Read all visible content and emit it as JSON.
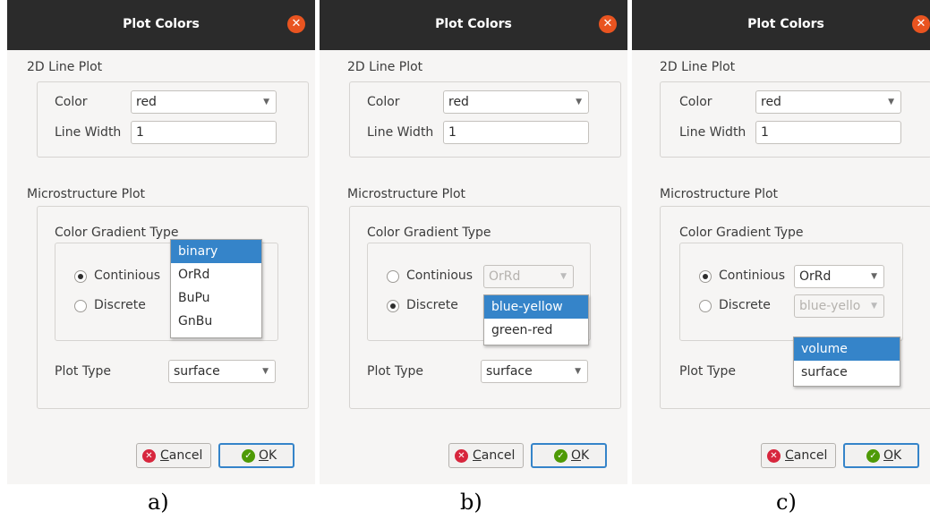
{
  "dialog_title": "Plot Colors",
  "close_glyph": "✕",
  "sections": {
    "line_plot": "2D Line Plot",
    "color_label": "Color",
    "color_value": "red",
    "line_width_label": "Line Width",
    "line_width_value": "1",
    "micro_plot": "Microstructure Plot",
    "gradient_type": "Color Gradient Type",
    "continuous": "Continious",
    "discrete": "Discrete",
    "plot_type_label": "Plot Type",
    "plot_type_value": "surface"
  },
  "panels": {
    "a": {
      "continuous_selected": true,
      "dropdown_options": [
        "binary",
        "OrRd",
        "BuPu",
        "GnBu"
      ],
      "highlighted": "binary",
      "caption": "a)"
    },
    "b": {
      "discrete_selected": true,
      "continuous_combo": "OrRd",
      "dropdown_options": [
        "blue-yellow",
        "green-red"
      ],
      "highlighted": "blue-yellow",
      "caption": "b)"
    },
    "c": {
      "continuous_selected": true,
      "continuous_combo": "OrRd",
      "discrete_combo": "blue-yello",
      "dropdown_options": [
        "volume",
        "surface"
      ],
      "highlighted": "volume",
      "caption": "c)"
    }
  },
  "buttons": {
    "cancel_first": "C",
    "cancel_rest": "ancel",
    "ok_first": "O",
    "ok_rest": "K"
  },
  "icons": [
    "close-icon",
    "cancel-icon",
    "checkmark-icon",
    "dropdown-arrow-icon"
  ],
  "colors": {
    "titlebar": "#2b2b2b",
    "close": "#e95420",
    "highlight": "#3584c9",
    "cancel_icon": "#d7263d",
    "ok_icon": "#4e9a06"
  }
}
